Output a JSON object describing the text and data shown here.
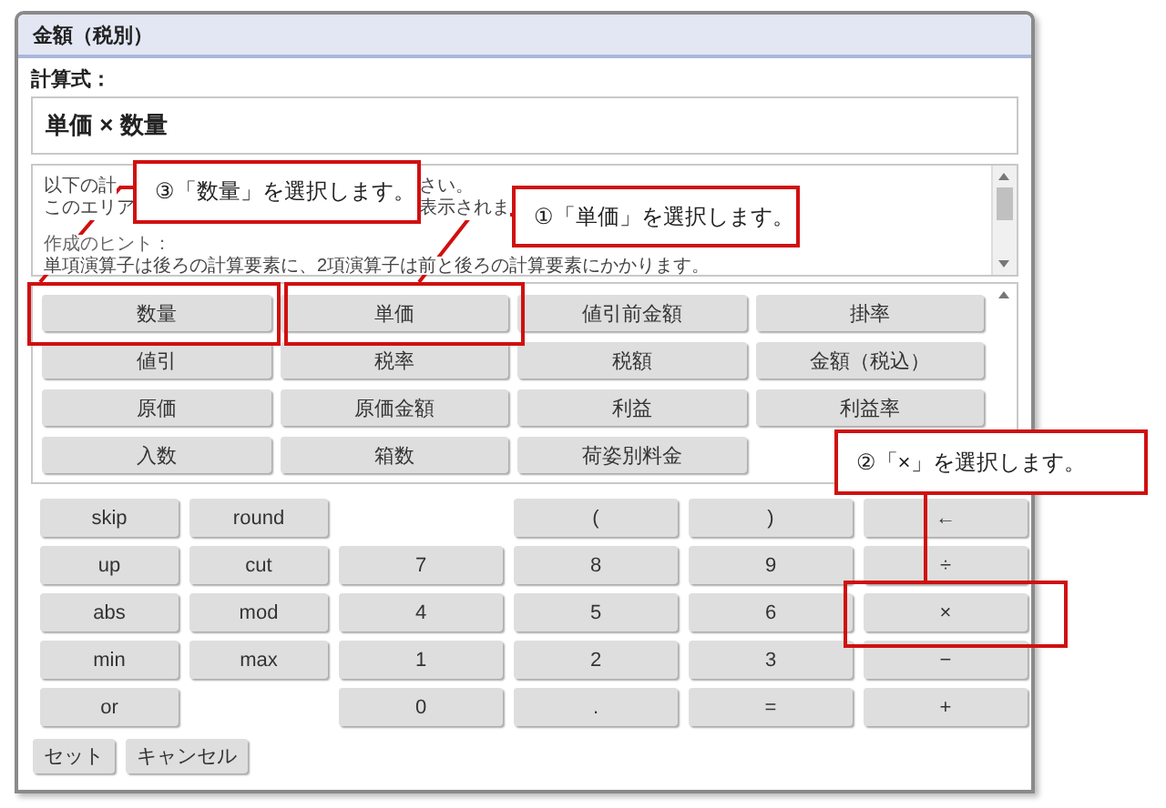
{
  "dialog": {
    "title": "金額（税別）"
  },
  "formula": {
    "label": "計算式：",
    "value": "単価 × 数量"
  },
  "help": {
    "lines": [
      [
        "以下の計",
        "さい。"
      ],
      [
        "このエリア",
        "表示されま"
      ],
      [
        "作成のヒント："
      ],
      [
        "単項演算子は後ろの計算要素に、2項演算子は前と後ろの計算要素にかかります。"
      ]
    ]
  },
  "fields": [
    "数量",
    "単価",
    "値引前金額",
    "掛率",
    "値引",
    "税率",
    "税額",
    "金額（税込）",
    "原価",
    "原価金額",
    "利益",
    "利益率",
    "入数",
    "箱数",
    "荷姿別料金"
  ],
  "keypad": {
    "rows": [
      [
        "skip",
        "round",
        null,
        "(",
        ")",
        "←"
      ],
      [
        "up",
        "cut",
        "7",
        "8",
        "9",
        "÷"
      ],
      [
        "abs",
        "mod",
        "4",
        "5",
        "6",
        "×"
      ],
      [
        "min",
        "max",
        "1",
        "2",
        "3",
        "−"
      ],
      [
        "or",
        null,
        "0",
        ".",
        "=",
        "+"
      ]
    ]
  },
  "buttons": [
    "セット",
    "キャンセル"
  ],
  "annotations": [
    {
      "text": "③「数量」を選択します。"
    },
    {
      "text": "①「単価」を選択します。"
    },
    {
      "text": "②「×」を選択します。"
    }
  ]
}
